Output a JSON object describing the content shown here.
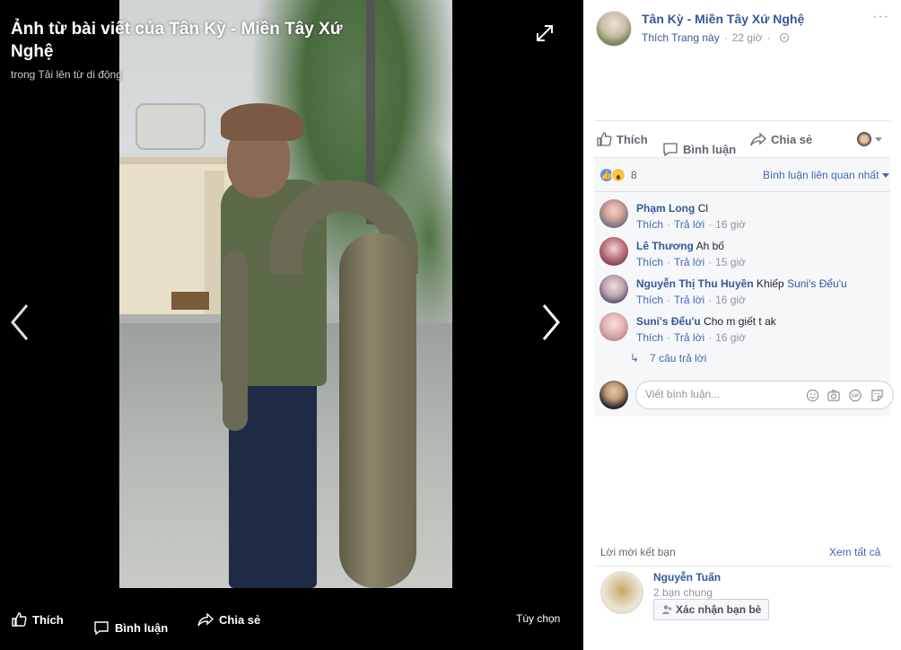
{
  "viewer": {
    "title": "Ảnh từ bài viết của Tân Kỳ - Miền Tây Xứ Nghệ",
    "subtitle": "trong Tải lên từ di động",
    "actions": {
      "like": "Thích",
      "comment": "Bình luận",
      "share": "Chia sẻ",
      "options": "Tùy chọn"
    }
  },
  "post": {
    "page_name": "Tân Kỳ - Miền Tây Xứ Nghệ",
    "like_page": "Thích Trang này",
    "time": "22 giờ",
    "more": "···"
  },
  "actions": {
    "like": "Thích",
    "comment": "Bình luận",
    "share": "Chia sẻ"
  },
  "reactions": {
    "count": "8",
    "sort": "Bình luận liên quan nhất"
  },
  "comments": [
    {
      "name": "Phạm Long",
      "text": "Cl",
      "tag": "",
      "like": "Thích",
      "reply": "Trả lời",
      "time": "16 giờ"
    },
    {
      "name": "Lê Thương",
      "text": "Ah bố",
      "tag": "",
      "like": "Thích",
      "reply": "Trả lời",
      "time": "15 giờ"
    },
    {
      "name": "Nguyễn Thị Thu Huyền",
      "text": "Khiếp",
      "tag": "Suni's Đểu'u",
      "like": "Thích",
      "reply": "Trả lời",
      "time": "16 giờ"
    },
    {
      "name": "Suni's Đểu'u",
      "text": "Cho m giết t ak",
      "tag": "",
      "like": "Thích",
      "reply": "Trả lời",
      "time": "16 giờ"
    }
  ],
  "replies_link": "7 câu trả lời",
  "write": {
    "placeholder": "Viết bình luận..."
  },
  "friend_requests": {
    "heading": "Lời mời kết bạn",
    "see_all": "Xem tất cả",
    "name": "Nguyễn Tuấn",
    "mutual": "2 bạn chung",
    "confirm": "Xác nhận bạn bè"
  },
  "colors": {
    "link": "#365899",
    "accent": "#4267b2",
    "muted": "#90949c"
  }
}
